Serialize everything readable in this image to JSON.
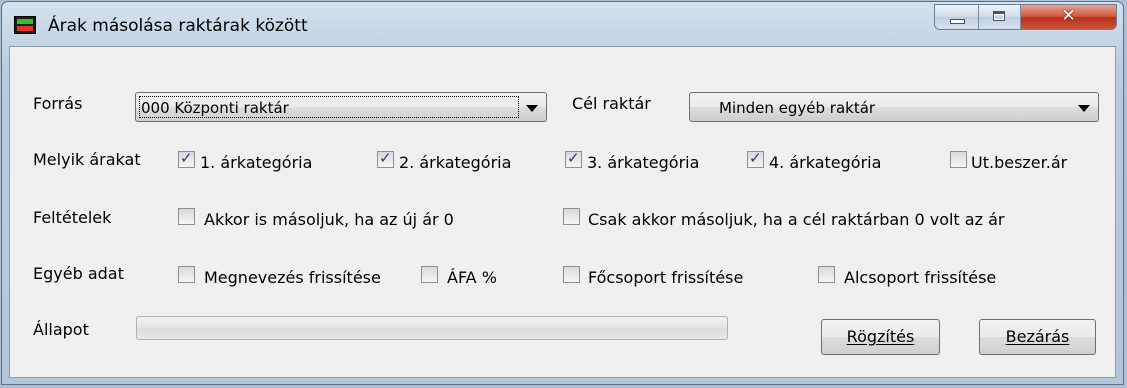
{
  "window": {
    "title": "Árak másolása raktárak között"
  },
  "form": {
    "source_label": "Forrás",
    "source_value": "000 Központi raktár",
    "target_label": "Cél raktár",
    "target_value": "Minden egyéb raktár",
    "prices_label": "Melyik árakat",
    "price_checkboxes": [
      {
        "label": "1. árkategória",
        "checked": true
      },
      {
        "label": "2. árkategória",
        "checked": true
      },
      {
        "label": "3. árkategória",
        "checked": true
      },
      {
        "label": "4. árkategória",
        "checked": true
      },
      {
        "label": "Ut.beszer.ár",
        "checked": false
      }
    ],
    "conditions_label": "Feltételek",
    "condition_checkboxes": [
      {
        "label": "Akkor is másoljuk, ha az új ár 0",
        "checked": false
      },
      {
        "label": "Csak akkor másoljuk, ha a cél raktárban 0 volt az ár",
        "checked": false
      }
    ],
    "other_label": "Egyéb adat",
    "other_checkboxes": [
      {
        "label": "Megnevezés frissítése",
        "checked": false
      },
      {
        "label": "ÁFA %",
        "checked": false
      },
      {
        "label": "Főcsoport frissítése",
        "checked": false
      },
      {
        "label": "Alcsoport frissítése",
        "checked": false
      }
    ],
    "status_label": "Állapot",
    "progress": 0
  },
  "buttons": {
    "save_label": "Rögzítés",
    "close_label": "Bezárás"
  },
  "icons": {
    "app": "app-icon",
    "minimize": "minimize-icon",
    "maximize": "maximize-icon",
    "close": "close-icon",
    "dropdown": "chevron-down-icon",
    "check": "checkmark-icon"
  }
}
